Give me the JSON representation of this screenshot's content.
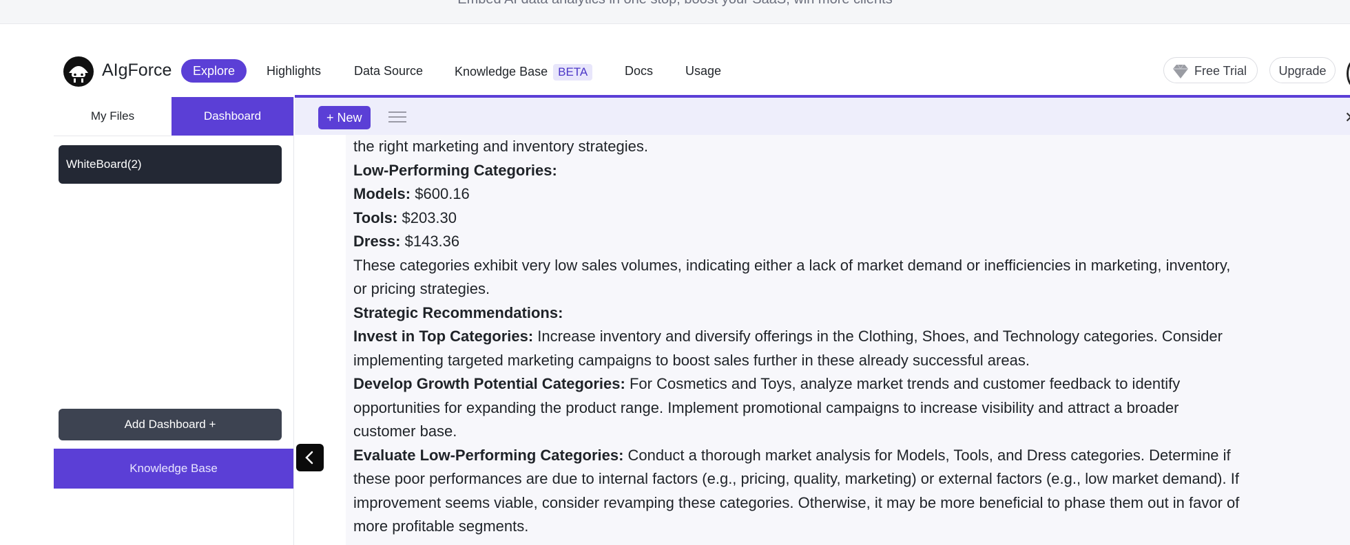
{
  "banner": {
    "text": "Embed AI data analytics in one stop, boost your SaaS, win more clients"
  },
  "brand": {
    "name": "AIgForce",
    "logo_icon": "robot-icon"
  },
  "nav": {
    "explore": "Explore",
    "highlights": "Highlights",
    "data_source": "Data Source",
    "knowledge_base": "Knowledge Base",
    "beta": "BETA",
    "docs": "Docs",
    "usage": "Usage",
    "free_trial": "Free Trial",
    "upgrade": "Upgrade"
  },
  "sidebar": {
    "tabs": {
      "files": "My Files",
      "dashboard": "Dashboard"
    },
    "whiteboard": "WhiteBoard(2)",
    "add_dashboard": "Add Dashboard +",
    "knowledge_base": "Knowledge Base"
  },
  "toolbar": {
    "new_label": "+ New",
    "close_icon": "close-icon"
  },
  "colors": {
    "accent": "#5b3fd6",
    "dark_item": "#232834",
    "content_bg": "#f7f7fb"
  },
  "content": {
    "clipped_top": "the right marketing and inventory strategies.",
    "low_heading": "Low-Performing Categories:",
    "models_label": "Models:",
    "models_value": "$600.16",
    "tools_label": "Tools:",
    "tools_value": "$203.30",
    "dress_label": "Dress:",
    "dress_value": "$143.36",
    "low_text_1": "These categories exhibit very low sales volumes, indicating either a lack of market demand or inefficiencies in marketing, inventory,",
    "low_text_2": "or pricing strategies.",
    "strategic_heading": "Strategic Recommendations:",
    "invest_label": "Invest in Top Categories:",
    "invest_text_1": " Increase inventory and diversify offerings in the Clothing, Shoes, and Technology categories. Consider",
    "invest_text_2": "implementing targeted marketing campaigns to boost sales further in these already successful areas.",
    "develop_label": "Develop Growth Potential Categories:",
    "develop_text_1": " For Cosmetics and Toys, analyze market trends and customer feedback to identify",
    "develop_text_2": "opportunities for expanding the product range. Implement promotional campaigns to increase visibility and attract a broader",
    "develop_text_3": "customer base.",
    "evaluate_label": "Evaluate Low-Performing Categories:",
    "evaluate_text_1": " Conduct a thorough market analysis for Models, Tools, and Dress categories. Determine if",
    "evaluate_text_2": "these poor performances are due to internal factors (e.g., pricing, quality, marketing) or external factors (e.g., low market demand). If",
    "evaluate_text_3": "improvement seems viable, consider revamping these categories. Otherwise, it may be more beneficial to phase them out in favor of",
    "evaluate_text_4": "more profitable segments."
  }
}
